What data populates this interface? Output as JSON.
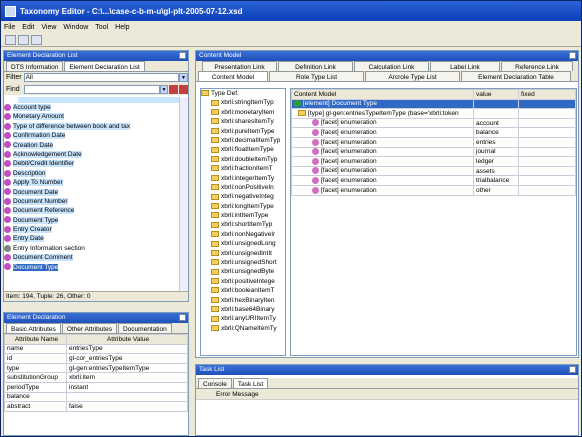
{
  "window": {
    "title": "Taxonomy Editor - C:\\...\\case-c-b-m-u\\gl-plt-2005-07-12.xsd"
  },
  "menu": [
    "File",
    "Edit",
    "View",
    "Window",
    "Tool",
    "Help"
  ],
  "decl_panel": {
    "title": "Element Declaration List",
    "tabs": [
      "DTS Information",
      "Element Declaration List"
    ],
    "filter_label": "Filter",
    "filter_value": "All",
    "find_label": "Find",
    "items": [
      "Account type",
      "Monetary Amount",
      "Type of difference between book and tax",
      "Confirmation Date",
      "Creation Date",
      "Acknowledgement Date",
      "Debit/Credit Identifier",
      "Description",
      "Apply To Number",
      "Document Date",
      "Document Number",
      "Document Reference",
      "Document Type",
      "Entry Creator",
      "Entry Date",
      "Entry Information section",
      "Document Comment",
      "Document Type"
    ],
    "status": "Item: 194, Tuple: 26, Other: 0"
  },
  "element_panel": {
    "title": "Element Declaration",
    "tabs": [
      "Basic Attributes",
      "Other Attributes",
      "Documentation"
    ],
    "headers": [
      "Attribute Name",
      "Attribute Value"
    ],
    "rows": [
      [
        "name",
        "entriesType"
      ],
      [
        "id",
        "gl-cor_entriesType"
      ],
      [
        "type",
        "gl-gen:entriesTypeItemType"
      ],
      [
        "substitutionGroup",
        "xbrli:item"
      ],
      [
        "periodType",
        "instant"
      ],
      [
        "balance",
        ""
      ],
      [
        "abstract",
        "false"
      ]
    ]
  },
  "content_panel": {
    "title": "Content Model",
    "tabs_row1": [
      "Presentation Link",
      "Definition Link",
      "Calculation Link",
      "Label Link",
      "Reference Link"
    ],
    "tabs_row2": [
      "Content Model",
      "Role Type List",
      "Arcrole Type List",
      "Element Declaration Table"
    ],
    "tree_root": "Type Def.",
    "tree_items": [
      "xbrli:stringItemTyp",
      "xbrli:monetaryItem",
      "xbrli:sharesItemTy",
      "xbrli:pureItemType",
      "xbrli:decimalItemTyp",
      "xbrli:floatItemType",
      "xbrli:doubleItemTyp",
      "xbrli:fractionItemT",
      "xbrli:integerItemTy",
      "xbrli:nonPositiveIn",
      "xbrli:negativeInteg",
      "xbrli:longItemType",
      "xbrli:intItemType",
      "xbrli:shortItemTyp",
      "xbrli:nonNegativeIr",
      "xbrli:unsignedLong",
      "xbrli:unsignedIntIt",
      "xbrli:unsignedShort",
      "xbrli:unsignedByte",
      "xbrli:positiveIntege",
      "xbrli:booleanItemT",
      "xbrli:hexBinaryIten",
      "xbrli:base64Binary",
      "xbrli:anyURIItemTy",
      "xbrli:QNameItemTy"
    ],
    "headers": [
      "Content Model",
      "value",
      "fixed"
    ],
    "model_rows": [
      {
        "label": "[element] Document Type",
        "value": "",
        "selected": true
      },
      {
        "label": "[type] gl-gen:entriesTypeItemType (base='xbrli:token",
        "value": "",
        "selected": false
      },
      {
        "label": "[facet] enumeration",
        "value": "account",
        "selected": false
      },
      {
        "label": "[facet] enumeration",
        "value": "balance",
        "selected": false
      },
      {
        "label": "[facet] enumeration",
        "value": "entries",
        "selected": false
      },
      {
        "label": "[facet] enumeration",
        "value": "journal",
        "selected": false
      },
      {
        "label": "[facet] enumeration",
        "value": "ledger",
        "selected": false
      },
      {
        "label": "[facet] enumeration",
        "value": "assets",
        "selected": false
      },
      {
        "label": "[facet] enumeration",
        "value": "trialbalance",
        "selected": false
      },
      {
        "label": "[facet] enumeration",
        "value": "other",
        "selected": false
      }
    ]
  },
  "task_panel": {
    "title": "Task List",
    "tabs": [
      "Console",
      "Task List"
    ],
    "column": "Error Message"
  }
}
